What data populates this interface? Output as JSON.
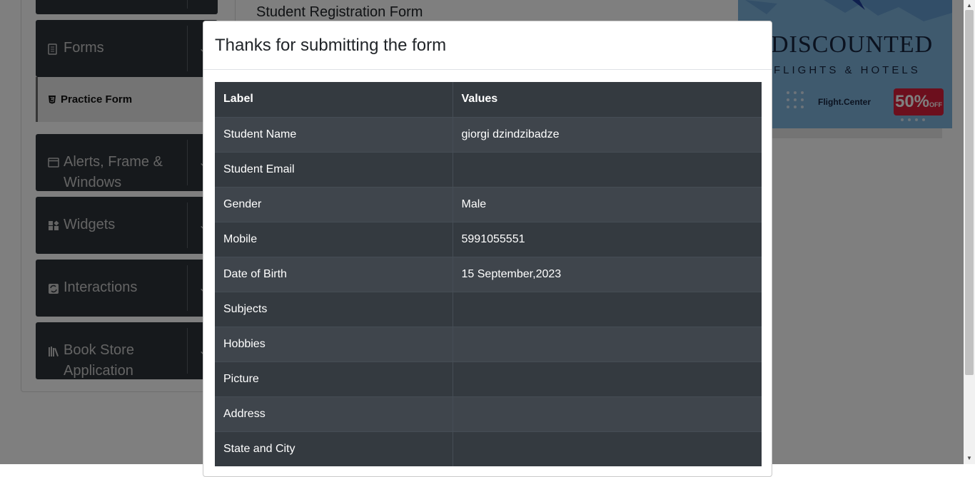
{
  "sidebar": {
    "groups": [
      {
        "label": "Forms",
        "icon": "document-icon"
      },
      {
        "label": "Alerts, Frame & Windows",
        "icon": "window-icon"
      },
      {
        "label": "Widgets",
        "icon": "widgets-icon"
      },
      {
        "label": "Interactions",
        "icon": "interactions-icon"
      },
      {
        "label": "Book Store Application",
        "icon": "book-icon"
      }
    ],
    "active_item": {
      "label": "Practice Form",
      "icon": "html5-icon"
    }
  },
  "main": {
    "title": "Student Registration Form"
  },
  "ad": {
    "headline": "DISCOUNTED",
    "subline": "FLIGHTS & HOTELS",
    "brand": "Flight.Center",
    "discount": "50%",
    "discount_suffix": "OFF"
  },
  "modal": {
    "title": "Thanks for submitting the form",
    "table": {
      "headers": {
        "label": "Label",
        "value": "Values"
      },
      "rows": [
        {
          "label": "Student Name",
          "value": "giorgi dzindzibadze"
        },
        {
          "label": "Student Email",
          "value": ""
        },
        {
          "label": "Gender",
          "value": "Male"
        },
        {
          "label": "Mobile",
          "value": "5991055551"
        },
        {
          "label": "Date of Birth",
          "value": "15 September,2023"
        },
        {
          "label": "Subjects",
          "value": ""
        },
        {
          "label": "Hobbies",
          "value": ""
        },
        {
          "label": "Picture",
          "value": ""
        },
        {
          "label": "Address",
          "value": ""
        },
        {
          "label": "State and City",
          "value": ""
        }
      ]
    }
  }
}
